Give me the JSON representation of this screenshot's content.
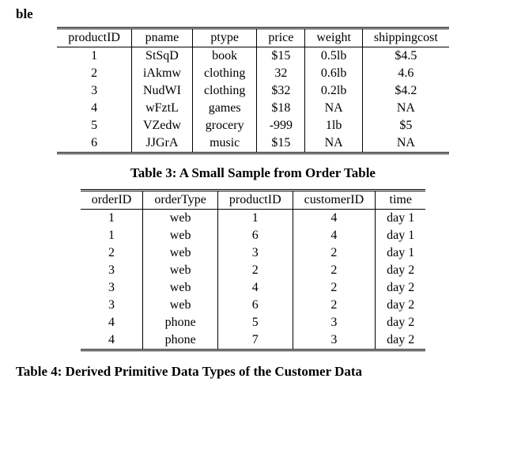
{
  "top_fragment": "ble",
  "product_table": {
    "headers": [
      "productID",
      "pname",
      "ptype",
      "price",
      "weight",
      "shippingcost"
    ],
    "rows": [
      [
        "1",
        "StSqD",
        "book",
        "$15",
        "0.5lb",
        "$4.5"
      ],
      [
        "2",
        "iAkmw",
        "clothing",
        "32",
        "0.6lb",
        "4.6"
      ],
      [
        "3",
        "NudWI",
        "clothing",
        "$32",
        "0.2lb",
        "$4.2"
      ],
      [
        "4",
        "wFztL",
        "games",
        "$18",
        "NA",
        "NA"
      ],
      [
        "5",
        "VZedw",
        "grocery",
        "-999",
        "1lb",
        "$5"
      ],
      [
        "6",
        "JJGrA",
        "music",
        "$15",
        "NA",
        "NA"
      ]
    ]
  },
  "order_caption": "Table 3: A Small Sample from Order Table",
  "order_table": {
    "headers": [
      "orderID",
      "orderType",
      "productID",
      "customerID",
      "time"
    ],
    "rows": [
      [
        "1",
        "web",
        "1",
        "4",
        "day 1"
      ],
      [
        "1",
        "web",
        "6",
        "4",
        "day 1"
      ],
      [
        "2",
        "web",
        "3",
        "2",
        "day 1"
      ],
      [
        "3",
        "web",
        "2",
        "2",
        "day 2"
      ],
      [
        "3",
        "web",
        "4",
        "2",
        "day 2"
      ],
      [
        "3",
        "web",
        "6",
        "2",
        "day 2"
      ],
      [
        "4",
        "phone",
        "5",
        "3",
        "day 2"
      ],
      [
        "4",
        "phone",
        "7",
        "3",
        "day 2"
      ]
    ]
  },
  "bottom_fragment": "Table 4: Derived Primitive Data Types of the Customer Data",
  "chart_data": [
    {
      "type": "table",
      "title": "Product Table (partial)",
      "columns": [
        "productID",
        "pname",
        "ptype",
        "price",
        "weight",
        "shippingcost"
      ],
      "rows": [
        [
          1,
          "StSqD",
          "book",
          "$15",
          "0.5lb",
          "$4.5"
        ],
        [
          2,
          "iAkmw",
          "clothing",
          "32",
          "0.6lb",
          "4.6"
        ],
        [
          3,
          "NudWI",
          "clothing",
          "$32",
          "0.2lb",
          "$4.2"
        ],
        [
          4,
          "wFztL",
          "games",
          "$18",
          "NA",
          "NA"
        ],
        [
          5,
          "VZedw",
          "grocery",
          "-999",
          "1lb",
          "$5"
        ],
        [
          6,
          "JJGrA",
          "music",
          "$15",
          "NA",
          "NA"
        ]
      ]
    },
    {
      "type": "table",
      "title": "Table 3: A Small Sample from Order Table",
      "columns": [
        "orderID",
        "orderType",
        "productID",
        "customerID",
        "time"
      ],
      "rows": [
        [
          1,
          "web",
          1,
          4,
          "day 1"
        ],
        [
          1,
          "web",
          6,
          4,
          "day 1"
        ],
        [
          2,
          "web",
          3,
          2,
          "day 1"
        ],
        [
          3,
          "web",
          2,
          2,
          "day 2"
        ],
        [
          3,
          "web",
          4,
          2,
          "day 2"
        ],
        [
          3,
          "web",
          6,
          2,
          "day 2"
        ],
        [
          4,
          "phone",
          5,
          3,
          "day 2"
        ],
        [
          4,
          "phone",
          7,
          3,
          "day 2"
        ]
      ]
    }
  ]
}
